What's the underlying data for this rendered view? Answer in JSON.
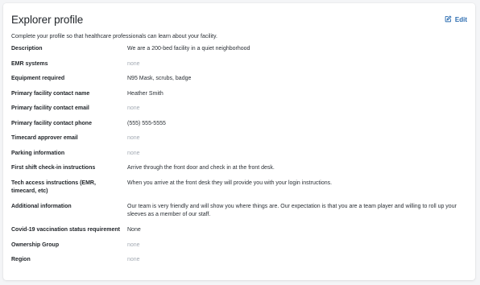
{
  "header": {
    "title": "Explorer profile",
    "edit_label": "Edit",
    "subtitle": "Complete your profile so that healthcare professionals can learn about your facility."
  },
  "fields": [
    {
      "label": "Description",
      "value": "We are a 200-bed facility in a quiet neighborhood"
    },
    {
      "label": "EMR systems",
      "value": "none"
    },
    {
      "label": "Equipment required",
      "value": "N95 Mask, scrubs, badge"
    },
    {
      "label": "Primary facility contact name",
      "value": "Heather Smith"
    },
    {
      "label": "Primary facility contact email",
      "value": "none"
    },
    {
      "label": "Primary facility contact phone",
      "value": "(555) 555-5555"
    },
    {
      "label": "Timecard approver email",
      "value": "none"
    },
    {
      "label": "Parking information",
      "value": "none"
    },
    {
      "label": "First shift check-in instructions",
      "value": "Arrive through the front door and check in at the front desk."
    },
    {
      "label": "Tech access instructions (EMR, timecard, etc)",
      "value": "When you arrive at the front desk they will provide you with your login instructions."
    },
    {
      "label": "Additional information",
      "value": "Our team is very friendly and will show you where things are. Our expectation is that you are a team player and willing to roll up your sleeves as a member of our staff."
    },
    {
      "label": "Covid-19 vaccination status requirement",
      "value": "None"
    },
    {
      "label": "Ownership Group",
      "value": "none"
    },
    {
      "label": "Region",
      "value": "none"
    }
  ],
  "colors": {
    "accent": "#2b6cb0",
    "empty_value": "#a3aab3"
  }
}
